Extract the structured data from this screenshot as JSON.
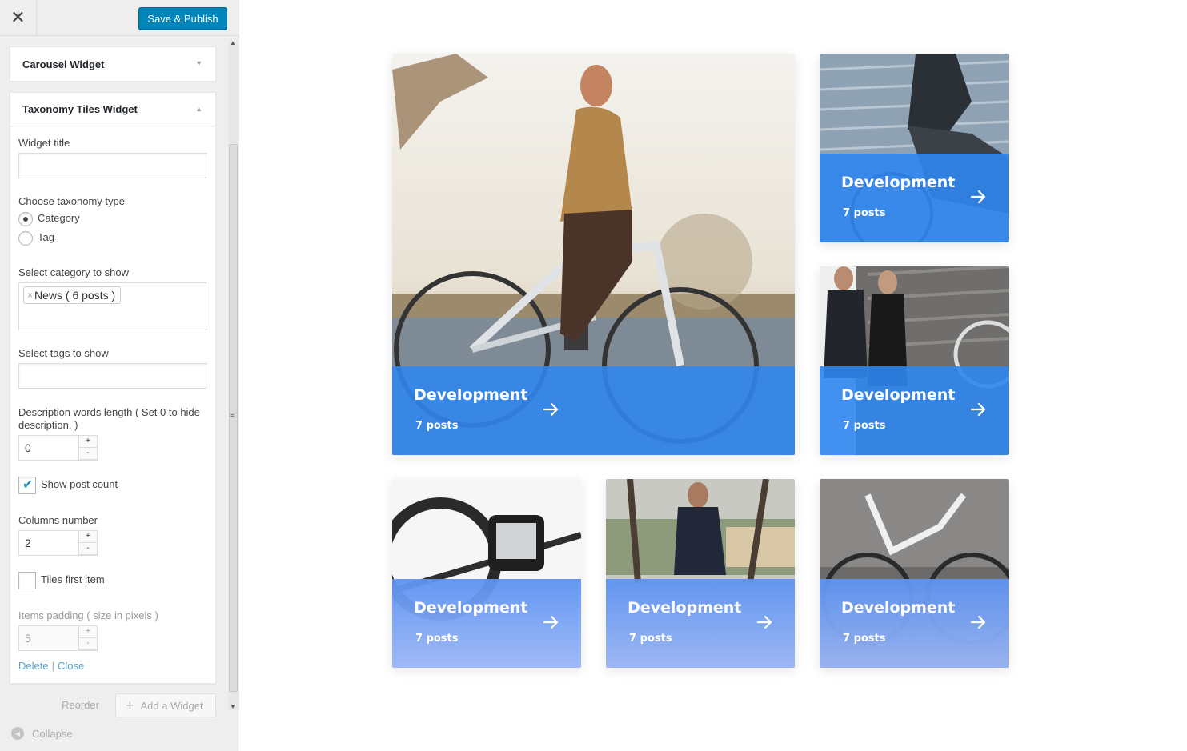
{
  "topbar": {
    "publish_label": "Save & Publish",
    "close_symbol": "✕"
  },
  "widgets": {
    "carousel": {
      "title": "Carousel Widget"
    },
    "taxonomy": {
      "title": "Taxonomy Tiles Widget"
    }
  },
  "form": {
    "widget_title_label": "Widget title",
    "widget_title_value": "",
    "taxonomy_type_label": "Choose taxonomy type",
    "taxonomy_options": [
      {
        "label": "Category",
        "selected": true
      },
      {
        "label": "Tag",
        "selected": false
      }
    ],
    "category_label": "Select category to show",
    "category_chip": "News ( 6 posts )",
    "tags_label": "Select tags to show",
    "desc_label": "Description words length ( Set 0 to hide description. )",
    "desc_value": "0",
    "show_count_label": "Show post count",
    "show_count_checked": true,
    "columns_label": "Columns number",
    "columns_value": "2",
    "tiles_first_label": "Tiles first item",
    "tiles_first_checked": false,
    "padding_label": "Items padding ( size in pixels )",
    "padding_value": "5",
    "spin_up": "+",
    "spin_down": "-",
    "delete_label": "Delete",
    "close_label": "Close",
    "sep": "|"
  },
  "footer": {
    "reorder_label": "Reorder",
    "add_widget_label": "Add a Widget",
    "collapse_label": "Collapse"
  },
  "tiles": [
    {
      "title": "Development",
      "count": "7 posts",
      "photo": "woman-on-ebike"
    },
    {
      "title": "Development",
      "count": "7 posts",
      "photo": "man-riding-city"
    },
    {
      "title": "Development",
      "count": "7 posts",
      "photo": "couple-with-bike"
    },
    {
      "title": "Development",
      "count": "7 posts",
      "photo": "bike-display"
    },
    {
      "title": "Development",
      "count": "7 posts",
      "photo": "man-in-suit-bike"
    },
    {
      "title": "Development",
      "count": "7 posts",
      "photo": "white-bike-concrete"
    }
  ],
  "colors": {
    "accent": "#0085ba",
    "tile_overlay": "#2f86f0",
    "tile_overlay_light": "#7aa6f5",
    "link": "#0073aa"
  }
}
